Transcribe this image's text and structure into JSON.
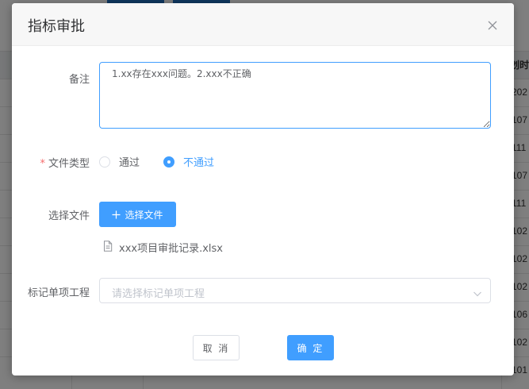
{
  "background": {
    "header_partial": "划时间",
    "row_values": [
      "202",
      "107",
      "111",
      "107",
      "111",
      "102",
      "102",
      "102",
      "106",
      "102",
      "101"
    ]
  },
  "dialog": {
    "title": "指标审批",
    "close_icon": "close-icon",
    "remark": {
      "label": "备注",
      "value": "1.xx存在xxx问题。2.xxx不正确"
    },
    "file_type": {
      "label": "文件类型",
      "required_mark": "*",
      "options": [
        {
          "label": "通过",
          "checked": false
        },
        {
          "label": "不通过",
          "checked": true
        }
      ]
    },
    "choose_file": {
      "label": "选择文件",
      "button_label": "选择文件",
      "button_icon": "plus-icon",
      "file_icon": "document-icon",
      "file_name": "xxx项目审批记录.xlsx"
    },
    "mark_project": {
      "label": "标记单项工程",
      "placeholder": "请选择标记单项工程",
      "icon": "chevron-down-icon"
    },
    "footer": {
      "cancel_label": "取 消",
      "confirm_label": "确 定"
    }
  },
  "colors": {
    "primary": "#409eff",
    "required": "#f56c6c",
    "text": "#606266",
    "placeholder": "#c0c4cc"
  }
}
